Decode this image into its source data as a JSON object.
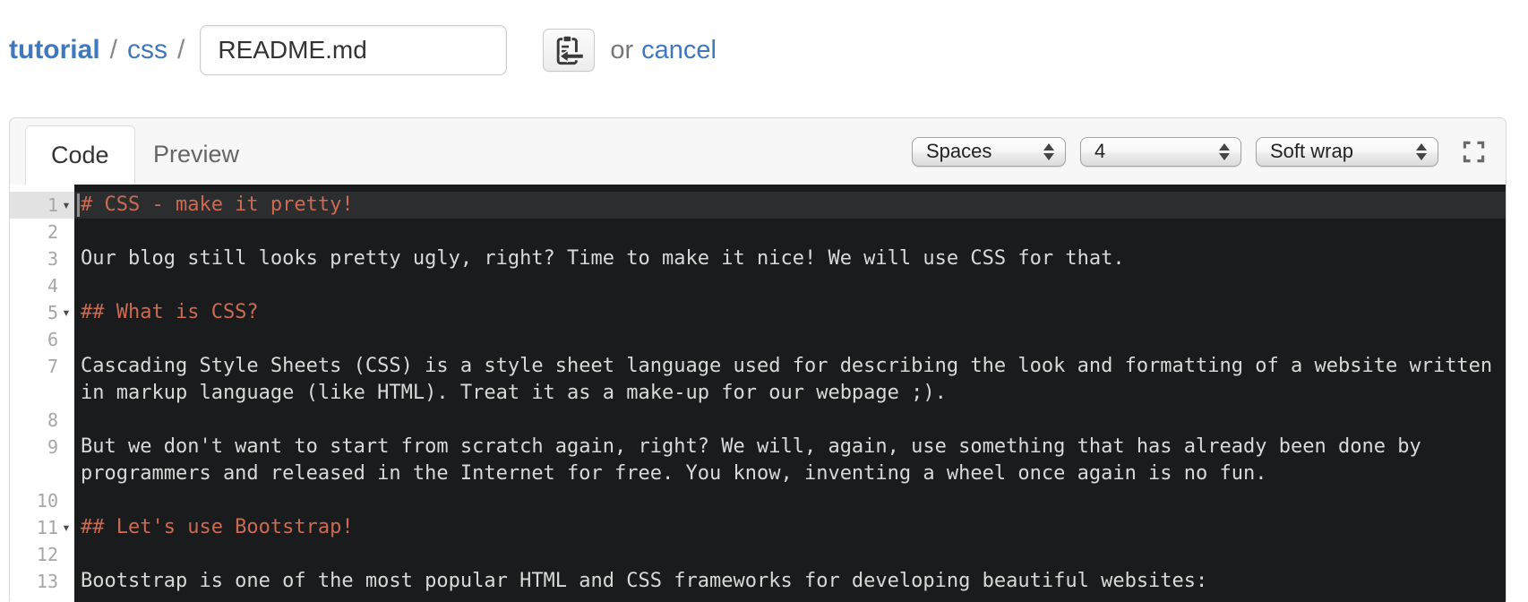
{
  "colors": {
    "link_blue": "#4078c0",
    "editor_background": "#1a1b1d",
    "editor_active_line": "#2c2d2f",
    "editor_heading_text": "#cc6a52",
    "editor_body_text": "#d8dad7",
    "gutter_background": "#ffffff",
    "gutter_number": "#a6a6a6",
    "tabnav_background": "#f7f7f7"
  },
  "breadcrumb": {
    "repo": "tutorial",
    "sep1": "/",
    "folder": "css",
    "sep2": "/"
  },
  "filename_input": {
    "value": "README.md"
  },
  "file_actions": {
    "button_icon": "clipboard-arrow-icon",
    "or_label": "or",
    "cancel_label": "cancel"
  },
  "tabs": {
    "code": "Code",
    "preview": "Preview"
  },
  "toolbar": {
    "indent_mode": "Spaces",
    "indent_size": "4",
    "wrap_mode": "Soft wrap",
    "fullscreen_icon": "fullscreen-icon"
  },
  "editor": {
    "fold_icon": "fold-arrow-icon",
    "rows": [
      {
        "num": "1",
        "fold": true,
        "kind": "heading",
        "active": true,
        "cursor": true,
        "text": "# CSS - make it pretty!"
      },
      {
        "num": "2",
        "text": ""
      },
      {
        "num": "3",
        "text": "Our blog still looks pretty ugly, right? Time to make it nice! We will use CSS for that."
      },
      {
        "num": "4",
        "text": ""
      },
      {
        "num": "5",
        "fold": true,
        "kind": "heading",
        "text": "## What is CSS?"
      },
      {
        "num": "6",
        "text": ""
      },
      {
        "num": "7",
        "text": "Cascading Style Sheets (CSS) is a style sheet language used for describing the look and formatting of a website written"
      },
      {
        "num": "",
        "wrap": true,
        "text": "in markup language (like HTML). Treat it as a make-up for our webpage ;)."
      },
      {
        "num": "8",
        "text": ""
      },
      {
        "num": "9",
        "text": "But we don't want to start from scratch again, right? We will, again, use something that has already been done by"
      },
      {
        "num": "",
        "wrap": true,
        "text": "programmers and released in the Internet for free. You know, inventing a wheel once again is no fun."
      },
      {
        "num": "10",
        "text": ""
      },
      {
        "num": "11",
        "fold": true,
        "kind": "heading",
        "text": "## Let's use Bootstrap!"
      },
      {
        "num": "12",
        "text": ""
      },
      {
        "num": "13",
        "text": "Bootstrap is one of the most popular HTML and CSS frameworks for developing beautiful websites:"
      }
    ]
  }
}
